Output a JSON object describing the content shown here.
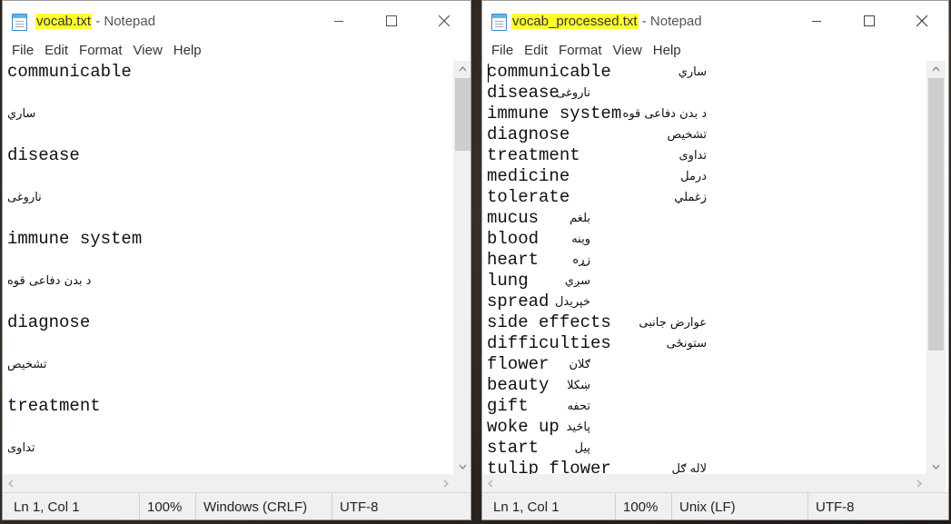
{
  "left_window": {
    "title_file": "vocab.txt",
    "title_app": " - Notepad",
    "menu": [
      "File",
      "Edit",
      "Format",
      "View",
      "Help"
    ],
    "lines": [
      {
        "text": "communicable",
        "lang": "en"
      },
      {
        "text": "ساري",
        "lang": "fa"
      },
      {
        "text": "disease",
        "lang": "en"
      },
      {
        "text": "ناروغی",
        "lang": "fa"
      },
      {
        "text": "immune system",
        "lang": "en"
      },
      {
        "text": "د بدن دفاعی قوه",
        "lang": "fa"
      },
      {
        "text": "diagnose",
        "lang": "en"
      },
      {
        "text": "تشخیص",
        "lang": "fa"
      },
      {
        "text": "treatment",
        "lang": "en"
      },
      {
        "text": "تداوی",
        "lang": "fa"
      }
    ],
    "status": {
      "position": "Ln 1, Col 1",
      "zoom": "100%",
      "line_ending": "Windows (CRLF)",
      "encoding": "UTF-8"
    }
  },
  "right_window": {
    "title_file": "vocab_processed.txt",
    "title_app": " - Notepad",
    "menu": [
      "File",
      "Edit",
      "Format",
      "View",
      "Help"
    ],
    "pairs": [
      {
        "en": "communicable",
        "fa": "ساري",
        "col": "wide"
      },
      {
        "en": "disease",
        "fa": "ناروغی",
        "col": "narrow"
      },
      {
        "en": "immune system",
        "fa": "د بدن دفاعی قوه",
        "col": "wide"
      },
      {
        "en": "diagnose",
        "fa": "تشخیص",
        "col": "wide"
      },
      {
        "en": "treatment",
        "fa": "تداوی",
        "col": "wide"
      },
      {
        "en": "medicine",
        "fa": "درمل",
        "col": "wide"
      },
      {
        "en": "tolerate",
        "fa": "زغملي",
        "col": "wide"
      },
      {
        "en": "mucus",
        "fa": "بلغم",
        "col": "narrow"
      },
      {
        "en": "blood",
        "fa": "وینه",
        "col": "narrow"
      },
      {
        "en": "heart",
        "fa": "زړه",
        "col": "narrow"
      },
      {
        "en": "lung",
        "fa": "سږي",
        "col": "narrow"
      },
      {
        "en": "spread",
        "fa": "خپریدل",
        "col": "narrow"
      },
      {
        "en": "side effects",
        "fa": "عوارض جانبی",
        "col": "wide"
      },
      {
        "en": "difficulties",
        "fa": "ستونځی",
        "col": "wide"
      },
      {
        "en": "flower",
        "fa": "ګلان",
        "col": "narrow"
      },
      {
        "en": "beauty",
        "fa": "ښکلا",
        "col": "narrow"
      },
      {
        "en": "gift",
        "fa": "تحفه",
        "col": "narrow"
      },
      {
        "en": "woke up",
        "fa": "پاڅید",
        "col": "narrow"
      },
      {
        "en": "start",
        "fa": "پیل",
        "col": "narrow"
      },
      {
        "en": "tulip flower",
        "fa": "لاله ګل",
        "col": "wide"
      }
    ],
    "status": {
      "position": "Ln 1, Col 1",
      "zoom": "100%",
      "line_ending": "Unix (LF)",
      "encoding": "UTF-8"
    }
  },
  "colors": {
    "title_highlight": "#ffff2e",
    "scroll_thumb": "#cdcdcd",
    "statusbar_bg": "#f0f0f0"
  },
  "icons": [
    "notepad-icon",
    "minimize-icon",
    "maximize-icon",
    "close-icon",
    "scroll-up-arrow-icon",
    "scroll-down-arrow-icon",
    "scroll-left-arrow-icon",
    "scroll-right-arrow-icon"
  ]
}
